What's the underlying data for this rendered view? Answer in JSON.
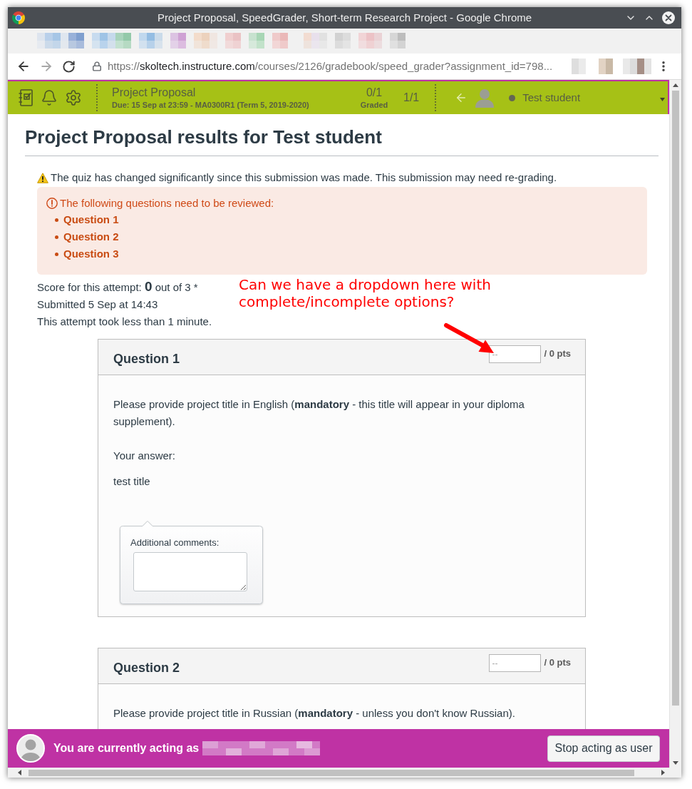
{
  "window": {
    "title": "Project Proposal, SpeedGrader, Short-term Research Project - Google Chrome"
  },
  "browser": {
    "address": {
      "scheme": "https://",
      "host": "skoltech.instructure.com",
      "path": "/courses/2126/gradebook/speed_grader?assignment_id=798..."
    },
    "forward_disabled": true
  },
  "speedgrader_bar": {
    "assignment": {
      "title": "Project Proposal",
      "due": "Due: 15 Sep at 23:59 - MA0300R1 (Term 5, 2019-2020)"
    },
    "graded": {
      "count": "0/1",
      "label": "Graded"
    },
    "position": "1/1",
    "student": {
      "name": "Test student"
    }
  },
  "results": {
    "heading": "Project Proposal results for Test student",
    "warning": "The quiz has changed significantly since this submission was made. This submission may need re-grading.",
    "review_alert": {
      "title": "The following questions need to be reviewed:",
      "links": [
        "Question 1",
        "Question 2",
        "Question 3"
      ]
    },
    "score": "Score for this attempt: **0** out of 3 *",
    "submitted": "Submitted 5 Sep at 14:43",
    "duration": "This attempt took less than 1 minute."
  },
  "annotation": {
    "text": "Can we have a dropdown here with complete/incomplete options?"
  },
  "questions": [
    {
      "title": "Question 1",
      "points": {
        "placeholder": "--",
        "total": "/ 0 pts"
      },
      "prompt": "Please provide project title in English (**mandatory** - this title will appear in your diploma supplement).",
      "answer_label": "Your answer:",
      "answer": "test title",
      "comments_label": "Additional comments:"
    },
    {
      "title": "Question 2",
      "points": {
        "placeholder": "--",
        "total": "/ 0 pts"
      },
      "prompt": "Please provide project title in Russian (**mandatory** - unless you don't know Russian)."
    }
  ],
  "masquerade_bar": {
    "message": "You are currently acting as",
    "button": "Stop acting as user"
  }
}
